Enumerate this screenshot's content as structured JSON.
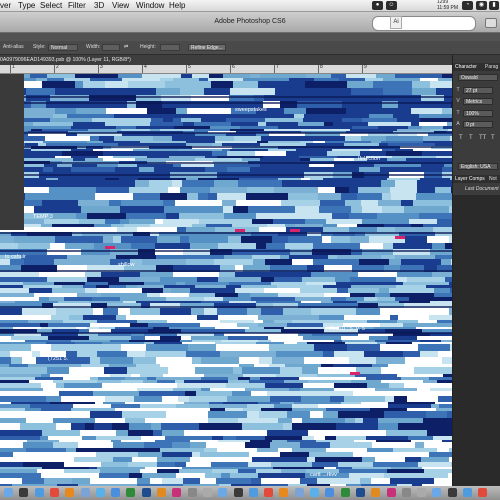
{
  "menubar": {
    "items": [
      "ver",
      "Type",
      "Select",
      "Filter",
      "3D",
      "View",
      "Window",
      "Help"
    ],
    "status_line1": "1299",
    "status_line2": "11:59 PM"
  },
  "window": {
    "title": "Adobe Photoshop CS6",
    "ai_badge": "Ai"
  },
  "options": {
    "anti_alias": "Anti-alias",
    "style_label": "Style:",
    "style_value": "Normal",
    "width_label": "Width:",
    "height_label": "Height:",
    "refine_edge": "Refine Edge..."
  },
  "document": {
    "tab_label": "0A0979096EAD149393.psb @ 100% (Layer 11, RGB/8*)"
  },
  "ruler": {
    "ticks": [
      "1",
      "2",
      "3",
      "4",
      "5",
      "6",
      "7",
      "8",
      "9"
    ]
  },
  "canvas": {
    "glitch_texts": [
      "sweepstakes",
      "Ifelection",
      "TEMP 3",
      "to cshuir",
      "sbillow",
      "Rnlll1i : 5 .V. 5",
      "(7251 5.",
      "cartt ...rkvv"
    ]
  },
  "panel": {
    "tab_character": "Character",
    "tab_paragraph": "Parag",
    "font_family": "Oswald",
    "font_size": "27 pt",
    "kerning": "Metrics",
    "scale": "100%",
    "baseline": "0 pt",
    "style_buttons": [
      "T",
      "T",
      "TT",
      "T"
    ],
    "language": "English: USA",
    "comps_tab": "Layer Comps",
    "comps_tab2": "Not",
    "last_document": "Last Document"
  },
  "colors": {
    "canvas_light": "#7fb4d3",
    "canvas_dark": "#1a3c8f",
    "panel_bg": "#3c3c3c"
  },
  "dock": {
    "icons": [
      "finder-icon",
      "dashboard-icon",
      "safari-icon",
      "chrome-icon",
      "firefox-icon",
      "mail-icon",
      "itunes-icon",
      "appstore-icon",
      "dreamweaver-icon",
      "photoshop-icon",
      "illustrator-icon",
      "indesign-icon",
      "preferences-icon",
      "trash-icon"
    ]
  }
}
